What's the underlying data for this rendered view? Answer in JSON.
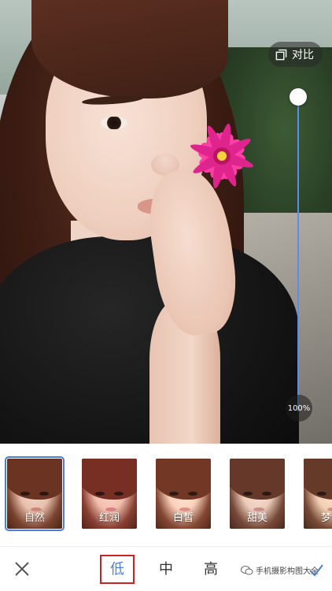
{
  "photo": {
    "compare_label": "对比",
    "slider_value": "100%"
  },
  "filters": [
    {
      "label": "自然",
      "selected": true
    },
    {
      "label": "红润",
      "selected": false
    },
    {
      "label": "白皙",
      "selected": false
    },
    {
      "label": "甜美",
      "selected": false
    },
    {
      "label": "梦",
      "selected": false
    }
  ],
  "toolbar": {
    "levels": [
      "低",
      "中",
      "高"
    ],
    "active_level": "低",
    "watermark": "手机摄影构图大全"
  },
  "colors": {
    "accent": "#4a7fd4",
    "highlight_box": "#cc2222"
  }
}
